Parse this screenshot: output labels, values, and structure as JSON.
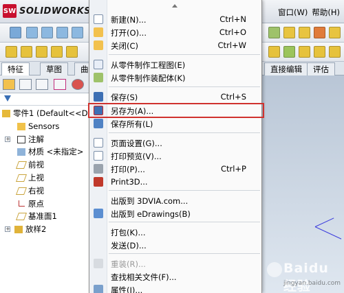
{
  "app": {
    "logo_badge": "SW",
    "logo_text": "SOLIDWORKS",
    "menus_right": [
      "窗口(W)",
      "帮助(H)"
    ]
  },
  "tabs": [
    "特征",
    "草图",
    "曲",
    "直接编辑",
    "评估"
  ],
  "tree": {
    "items": [
      {
        "label": "零件1  (Default<<D",
        "icon": "part-icon"
      },
      {
        "label": "Sensors",
        "icon": "sensor-icon"
      },
      {
        "label": "注解",
        "icon": "annotation-icon"
      },
      {
        "label": "材质 <未指定>",
        "icon": "material-icon"
      },
      {
        "label": "前视",
        "icon": "plane-icon"
      },
      {
        "label": "上视",
        "icon": "plane-icon"
      },
      {
        "label": "右视",
        "icon": "plane-icon"
      },
      {
        "label": "原点",
        "icon": "origin-icon"
      },
      {
        "label": "基准面1",
        "icon": "plane-icon"
      },
      {
        "label": "放样2",
        "icon": "loft-icon"
      }
    ]
  },
  "file_menu": {
    "items": [
      {
        "label": "新建(N)...",
        "shortcut": "Ctrl+N",
        "icon": "new-file-icon",
        "disabled": false
      },
      {
        "label": "打开(O)...",
        "shortcut": "Ctrl+O",
        "icon": "open-folder-icon",
        "disabled": false
      },
      {
        "label": "关闭(C)",
        "shortcut": "Ctrl+W",
        "icon": "close-folder-icon",
        "disabled": false
      },
      {
        "label": "从零件制作工程图(E)",
        "shortcut": "",
        "icon": "drawing-icon",
        "disabled": false
      },
      {
        "label": "从零件制作装配体(K)",
        "shortcut": "",
        "icon": "assembly-icon",
        "disabled": false
      },
      {
        "label": "保存(S)",
        "shortcut": "Ctrl+S",
        "icon": "save-icon",
        "disabled": false
      },
      {
        "label": "另存为(A)...",
        "shortcut": "",
        "icon": "save-as-icon",
        "disabled": false
      },
      {
        "label": "保存所有(L)",
        "shortcut": "",
        "icon": "save-all-icon",
        "disabled": false
      },
      {
        "label": "页面设置(G)...",
        "shortcut": "",
        "icon": "page-setup-icon",
        "disabled": false
      },
      {
        "label": "打印预览(V)...",
        "shortcut": "",
        "icon": "print-preview-icon",
        "disabled": false
      },
      {
        "label": "打印(P)...",
        "shortcut": "Ctrl+P",
        "icon": "printer-icon",
        "disabled": false
      },
      {
        "label": "Print3D...",
        "shortcut": "",
        "icon": "print3d-icon",
        "disabled": false
      },
      {
        "label": "出版到 3DVIA.com...",
        "shortcut": "",
        "icon": "",
        "disabled": false
      },
      {
        "label": "出版到 eDrawings(B)",
        "shortcut": "",
        "icon": "edrawings-icon",
        "disabled": false
      },
      {
        "label": "打包(K)...",
        "shortcut": "",
        "icon": "",
        "disabled": false
      },
      {
        "label": "发送(D)...",
        "shortcut": "",
        "icon": "",
        "disabled": false
      },
      {
        "label": "重装(R)...",
        "shortcut": "",
        "icon": "reload-icon",
        "disabled": true
      },
      {
        "label": "查找相关文件(F)...",
        "shortcut": "",
        "icon": "",
        "disabled": false
      },
      {
        "label": "属性(I)...",
        "shortcut": "",
        "icon": "properties-icon",
        "disabled": false
      }
    ]
  },
  "watermark": {
    "text": "Baidu 经验",
    "sub": "jingyan.baidu.com"
  }
}
